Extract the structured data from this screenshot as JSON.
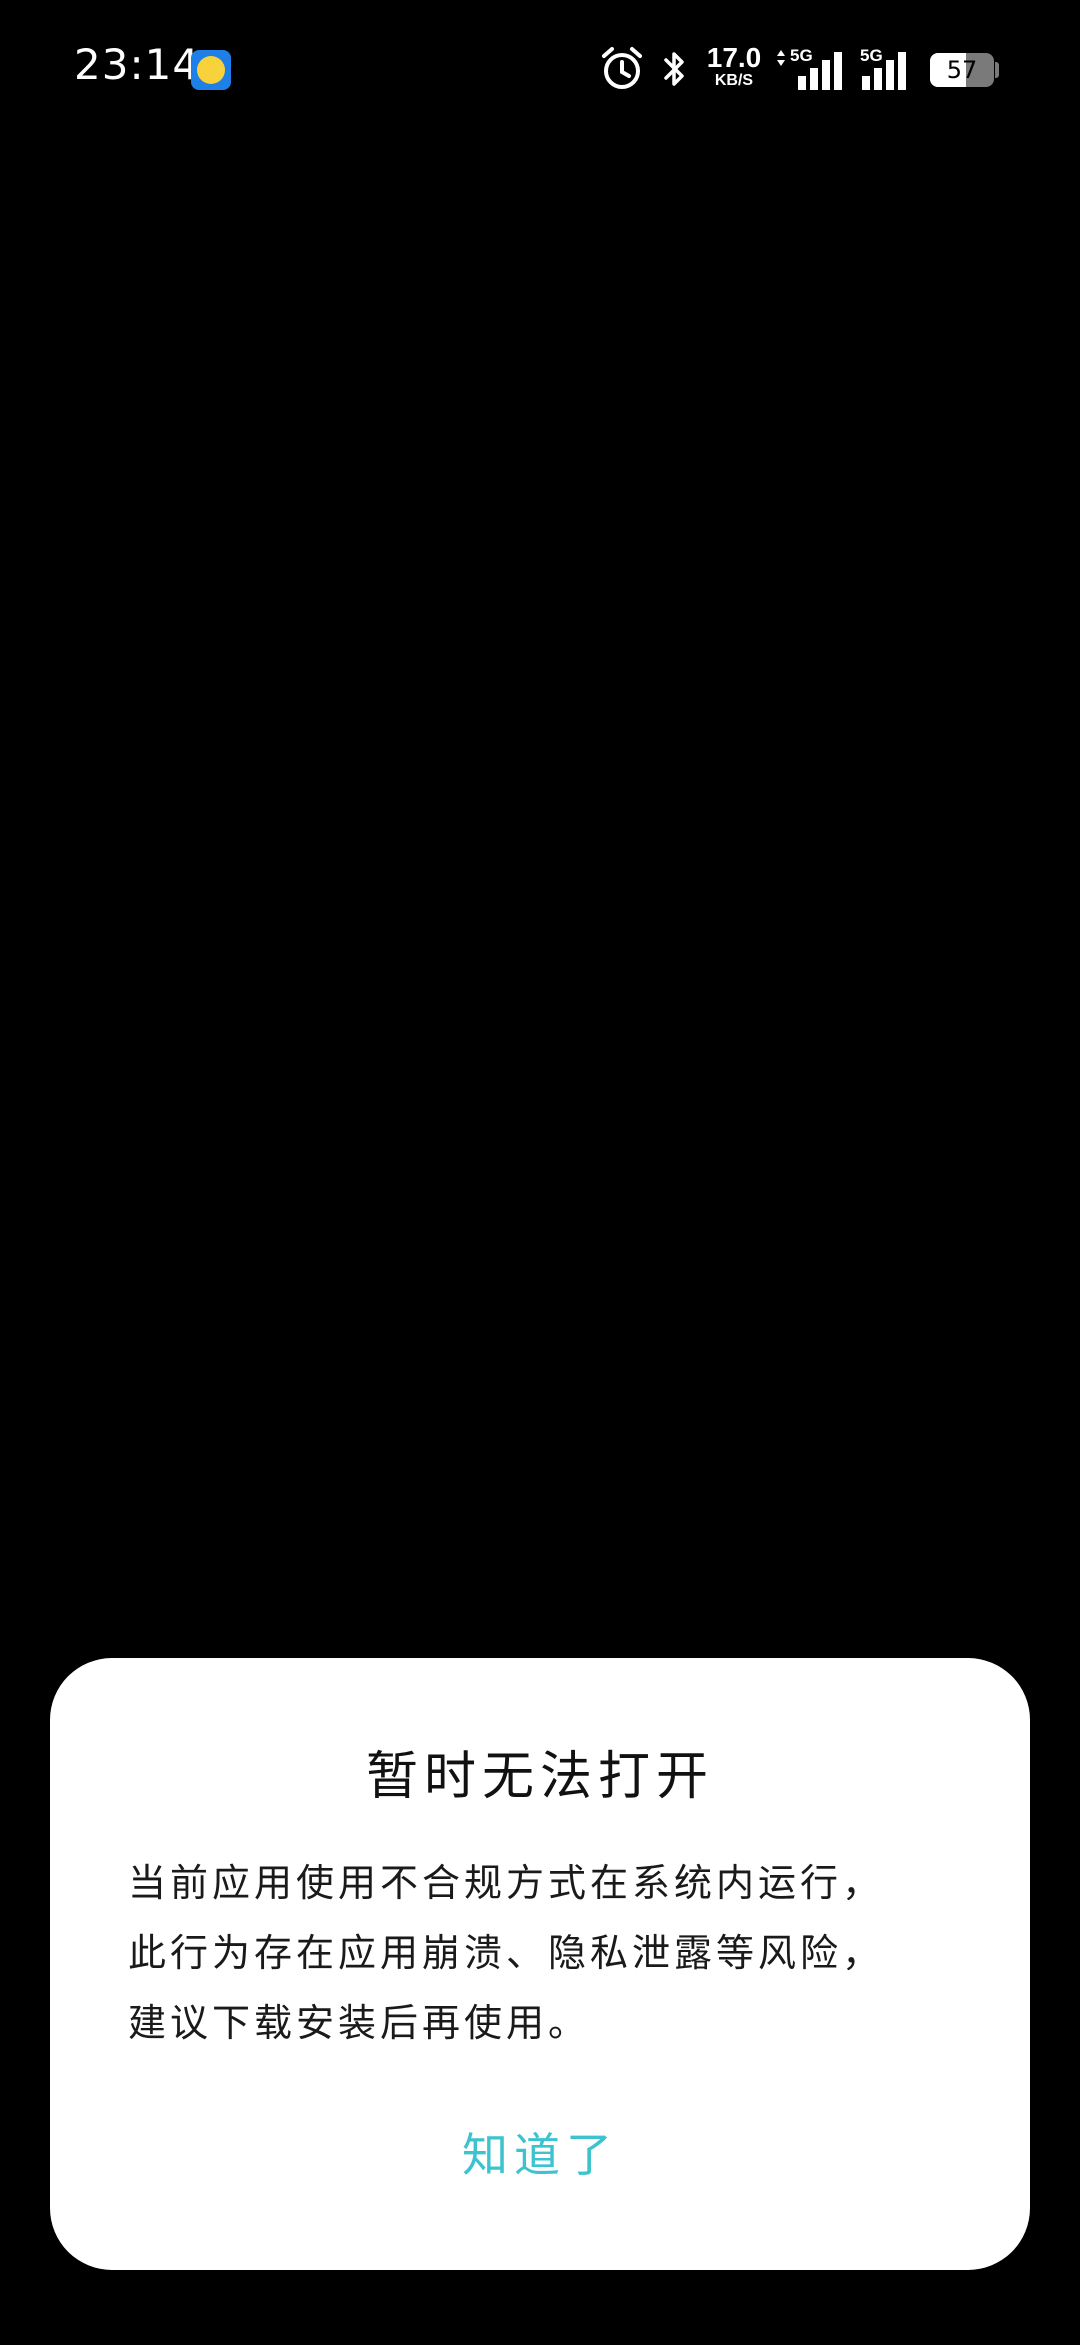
{
  "status_bar": {
    "time": "23:14",
    "notification_app_icon": "yellow-chick-app-icon",
    "icons": [
      "alarm-icon",
      "bluetooth-icon"
    ],
    "network_speed": "17.0",
    "network_speed_unit": "KB/S",
    "sim1_network": "5G",
    "sim2_network": "5G",
    "battery_level": "57"
  },
  "dialog": {
    "title": "暂时无法打开",
    "message_lines": [
      "当前应用使用不合规方式在系统内运行，",
      "此行为存在应用崩溃、隐私泄露等风险，",
      "建议下载安装后再使用。"
    ],
    "ok_label": "知道了",
    "ok_color": "#3cc3cf"
  }
}
